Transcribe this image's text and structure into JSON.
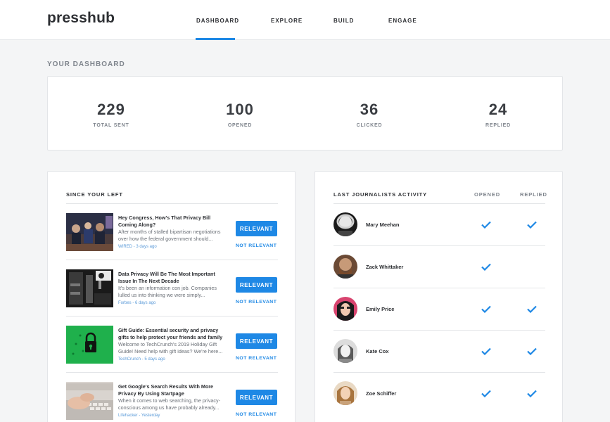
{
  "app": {
    "logo": "presshub"
  },
  "nav": [
    {
      "label": "DASHBOARD",
      "active": true
    },
    {
      "label": "EXPLORE",
      "active": false
    },
    {
      "label": "BUILD",
      "active": false
    },
    {
      "label": "ENGAGE",
      "active": false
    }
  ],
  "dashboard": {
    "title": "YOUR DASHBOARD",
    "stats": [
      {
        "value": "229",
        "label": "TOTAL SENT"
      },
      {
        "value": "100",
        "label": "OPENED"
      },
      {
        "value": "36",
        "label": "CLICKED"
      },
      {
        "value": "24",
        "label": "REPLIED"
      }
    ]
  },
  "since_left": {
    "title": "SINCE YOUR LEFT",
    "relevant_label": "RELEVANT",
    "not_relevant_label": "NOT RELEVANT",
    "articles": [
      {
        "title": "Hey Congress, How's That Privacy Bill Coming Along?",
        "snippet": "After months of stalled bipartisan negotiations over how the federal government should...",
        "meta": "WIRED - 3 days ago",
        "thumb": "congress-hearing-photo"
      },
      {
        "title": "Data Privacy Will Be The Most Important Issue In The Next Decade",
        "snippet": "It's been an information con job. Companies lulled us into thinking we were simply...",
        "meta": "Forbes - 6 days ago",
        "thumb": "surveillance-camera-photo"
      },
      {
        "title": "Gift Guide: Essential security and privacy gifts to help protect your friends and family",
        "snippet": "Welcome to TechCrunch's 2019 Holiday Gift Guide! Need help with gift ideas? We're here...",
        "meta": "TechCrunch - 5 days ago",
        "thumb": "green-padlock-illustration"
      },
      {
        "title": "Get Google's Search Results With More Privacy By Using Startpage",
        "snippet": "When it comes to web searching, the privacy-conscious among us have probably already...",
        "meta": "Lifehacker - Yesterday",
        "thumb": "hands-typing-keyboard-photo"
      }
    ]
  },
  "journalists": {
    "title": "LAST JOURNALISTS ACTIVITY",
    "col_opened": "OPENED",
    "col_replied": "REPLIED",
    "check_color": "#1e88e5",
    "rows": [
      {
        "name": "Mary Meehan",
        "opened": true,
        "replied": true
      },
      {
        "name": "Zack Whittaker",
        "opened": true,
        "replied": false
      },
      {
        "name": "Emily Price",
        "opened": true,
        "replied": true
      },
      {
        "name": "Kate Cox",
        "opened": true,
        "replied": true
      },
      {
        "name": "Zoe Schiffer",
        "opened": true,
        "replied": true
      }
    ]
  },
  "colors": {
    "accent": "#1e88e5",
    "background": "#f4f5f6",
    "card": "#ffffff"
  }
}
